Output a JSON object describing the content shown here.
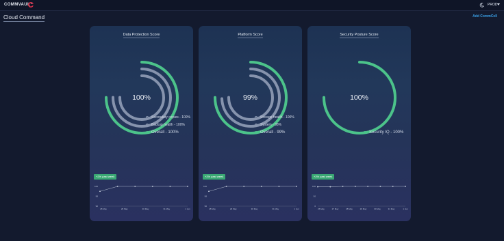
{
  "header": {
    "brand": "COMMVAULT",
    "environment": "PROD",
    "icons": {
      "brand": "commvault-logo-icon",
      "theme": "moon-icon",
      "caret": "chevron-down-icon"
    }
  },
  "page": {
    "title": "Cloud Command",
    "add_link": "Add CommCell"
  },
  "colors": {
    "accent_green": "#4cc38a",
    "track_gray": "#8693ad",
    "card_bg": "#22385a",
    "link_blue": "#3aa0e6"
  },
  "cards": [
    {
      "title": "Data Protection Score",
      "center_value": "100%",
      "rings": [
        {
          "label": "Secondary copies - 100%",
          "value": 1.0,
          "color": "gray"
        },
        {
          "label": "Backup health - 100%",
          "value": 1.0,
          "color": "gray"
        },
        {
          "label": "Overall - 100%",
          "value": 1.0,
          "color": "green"
        }
      ],
      "badge": "+2% past week",
      "trend": {
        "y_ticks": [
          "100",
          "98",
          "96"
        ],
        "x_labels": [
          "28 May",
          "29 May",
          "30 May",
          "31 May",
          "1 Jun"
        ],
        "values": [
          99,
          100,
          100,
          100,
          100,
          100
        ]
      }
    },
    {
      "title": "Platform Score",
      "center_value": "99%",
      "rings": [
        {
          "label": "Storage health - 100%",
          "value": 1.0,
          "color": "gray"
        },
        {
          "label": "System - 98%",
          "value": 0.98,
          "color": "gray"
        },
        {
          "label": "Overall - 99%",
          "value": 0.99,
          "color": "green"
        }
      ],
      "badge": "+2% past week",
      "trend": {
        "y_ticks": [
          "100",
          "98",
          "96"
        ],
        "x_labels": [
          "28 May",
          "29 May",
          "30 May",
          "31 May",
          "1 Jun"
        ],
        "values": [
          99,
          100,
          100,
          100,
          100,
          100
        ]
      }
    },
    {
      "title": "Security Posture Score",
      "center_value": "100%",
      "rings": [
        {
          "label": "Security IQ - 100%",
          "value": 1.0,
          "color": "green"
        }
      ],
      "badge": "+2% past week",
      "trend": {
        "y_ticks": [
          "100",
          "50",
          "0"
        ],
        "x_labels": [
          "26 May",
          "27 May",
          "28 May",
          "29 May",
          "30 May",
          "31 May",
          "1 Jun"
        ],
        "values": [
          98,
          98,
          100,
          100,
          100,
          100,
          100,
          100
        ]
      }
    }
  ]
}
